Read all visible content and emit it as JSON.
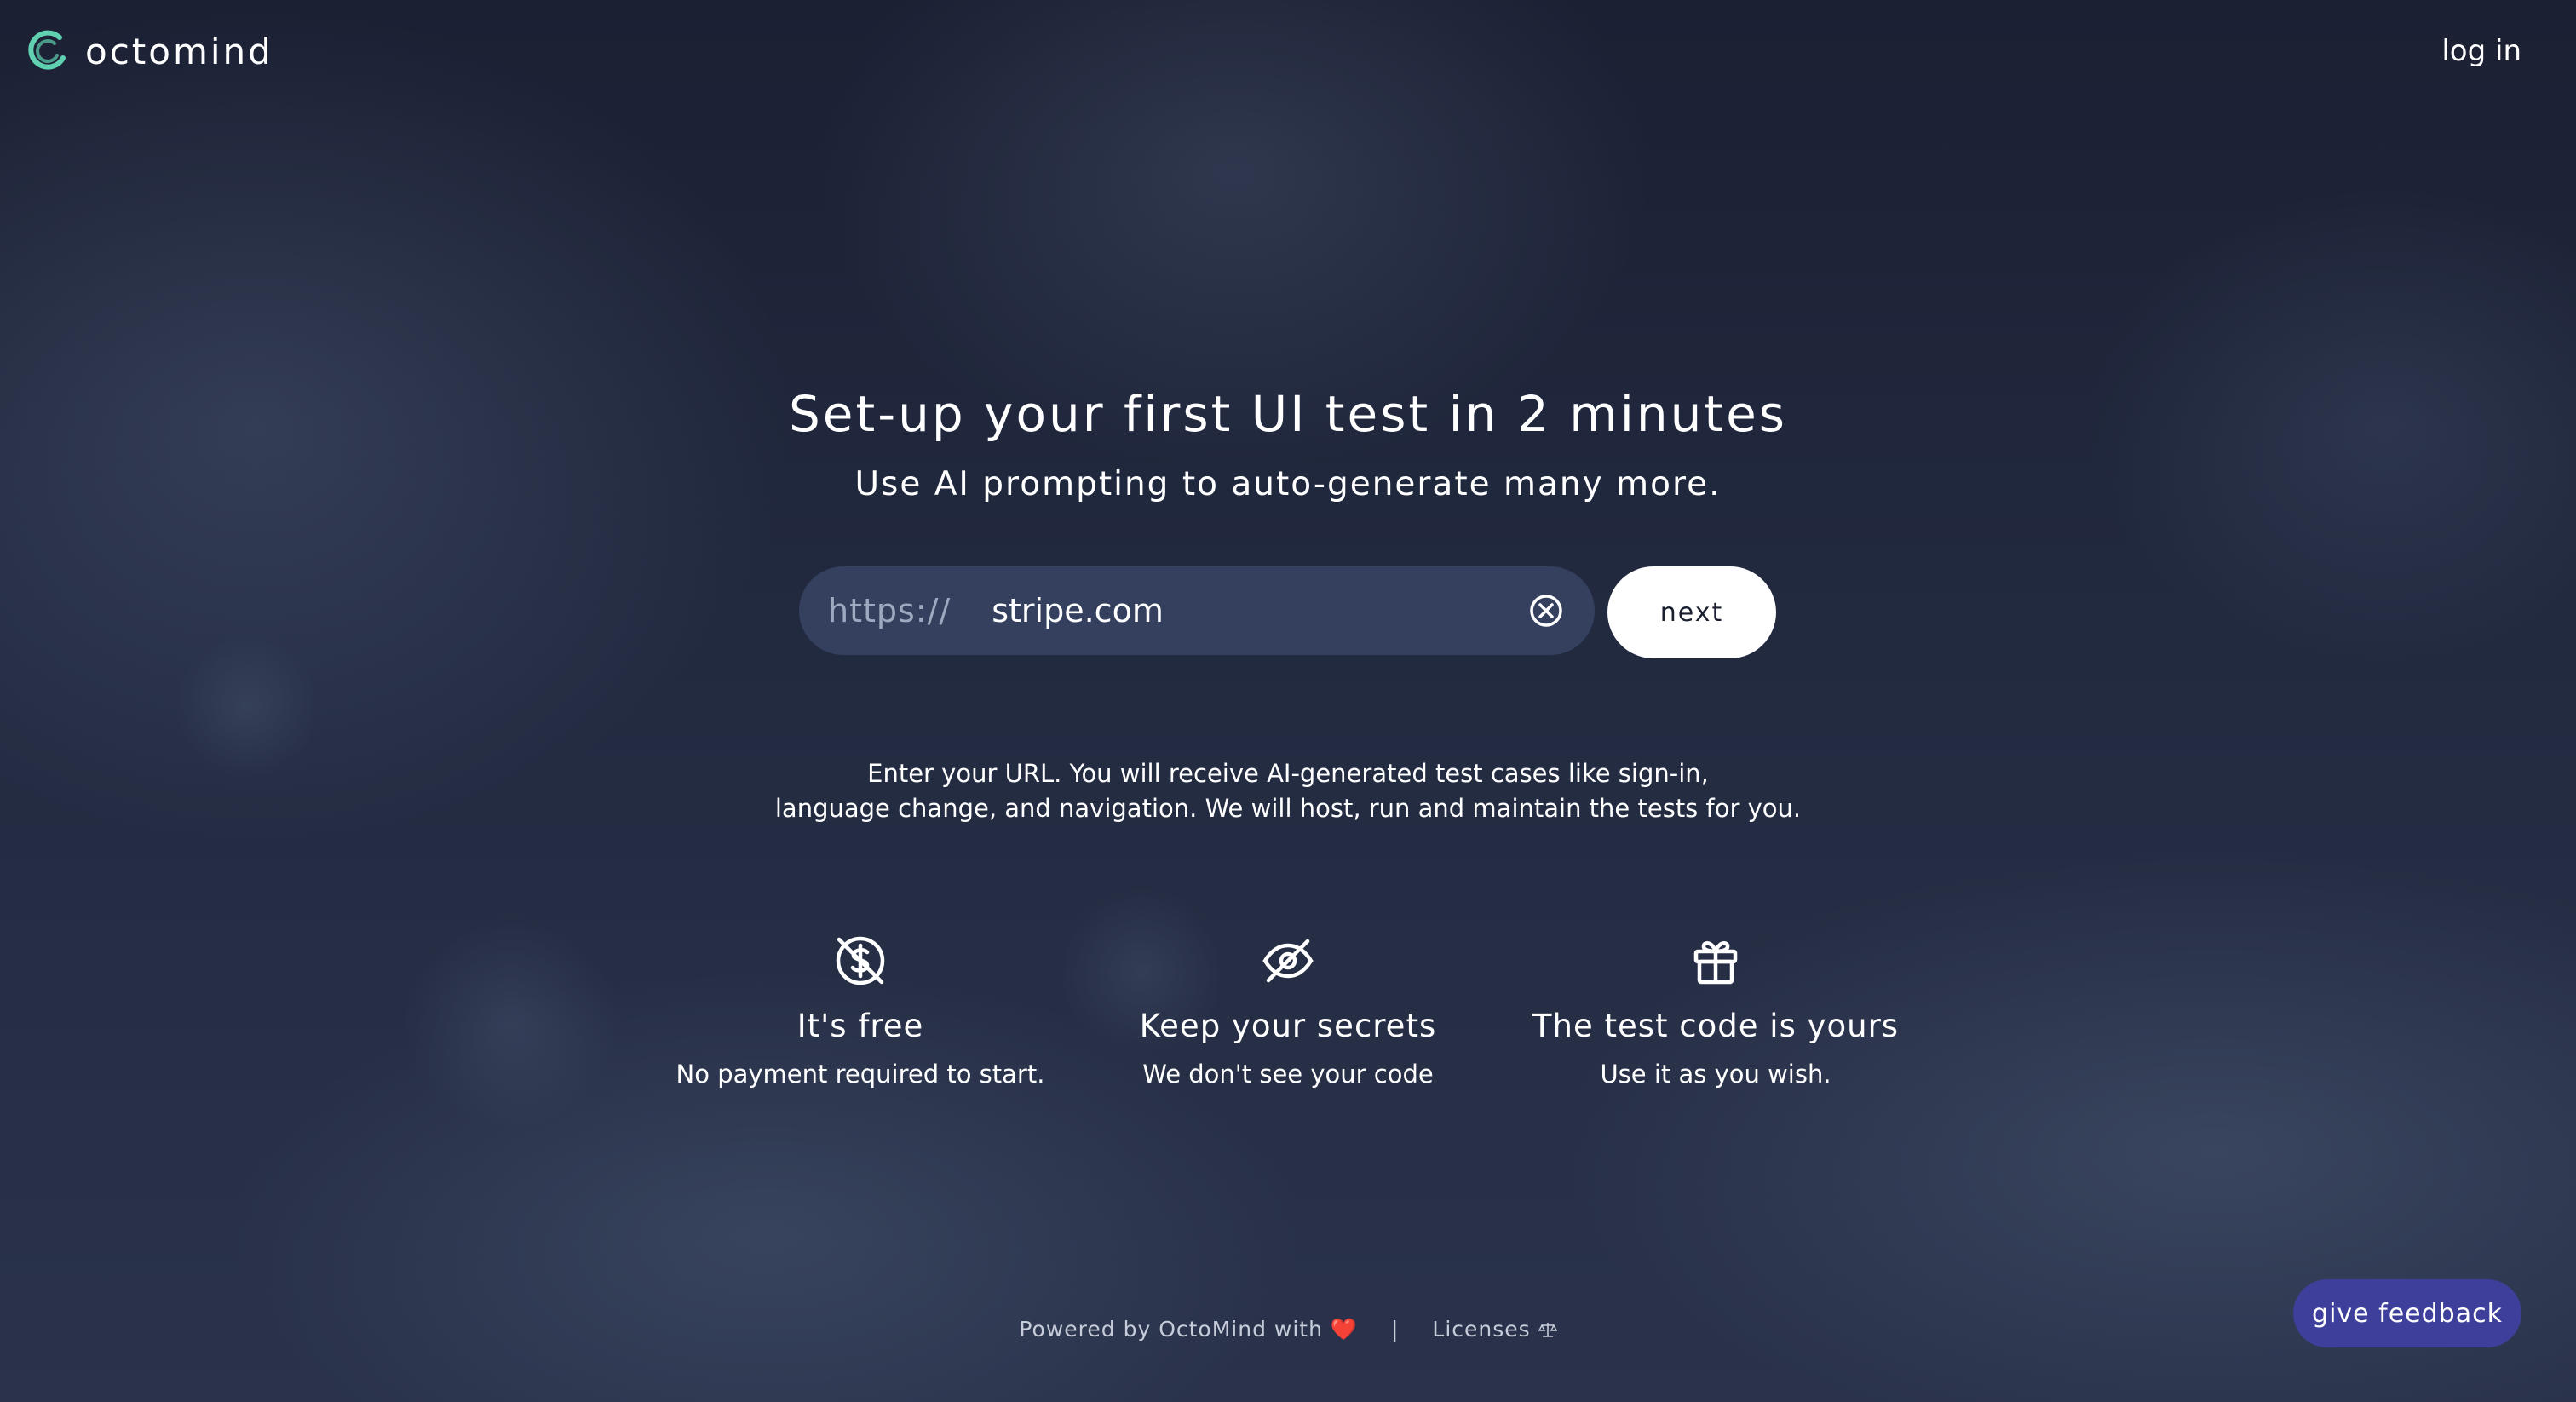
{
  "header": {
    "logo_text": "octomind",
    "login_label": "log in"
  },
  "hero": {
    "title": "Set-up your first UI test in 2 minutes",
    "subtitle": "Use AI prompting to auto-generate many more."
  },
  "url_form": {
    "prefix": "https://",
    "value": "stripe.com",
    "next_label": "next"
  },
  "description": {
    "line1": "Enter your URL. You will receive AI-generated test cases like sign-in,",
    "line2": "language change, and navigation. We will host, run and maintain the tests for you."
  },
  "features": [
    {
      "icon": "dollar-off-icon",
      "title": "It's free",
      "description": "No payment required to start."
    },
    {
      "icon": "eye-off-icon",
      "title": "Keep your secrets",
      "description": "We don't see your code"
    },
    {
      "icon": "gift-icon",
      "title": "The test code is yours",
      "description": "Use it as you wish."
    }
  ],
  "footer": {
    "powered_by": "Powered by OctoMind with",
    "heart": "❤️",
    "separator": "|",
    "licenses_label": "Licenses",
    "licenses_icon": "scale-icon"
  },
  "feedback_label": "give feedback",
  "colors": {
    "accent_logo": "#5fd0b0",
    "feedback_button": "#3e3f9a",
    "input_background": "#34405e"
  }
}
